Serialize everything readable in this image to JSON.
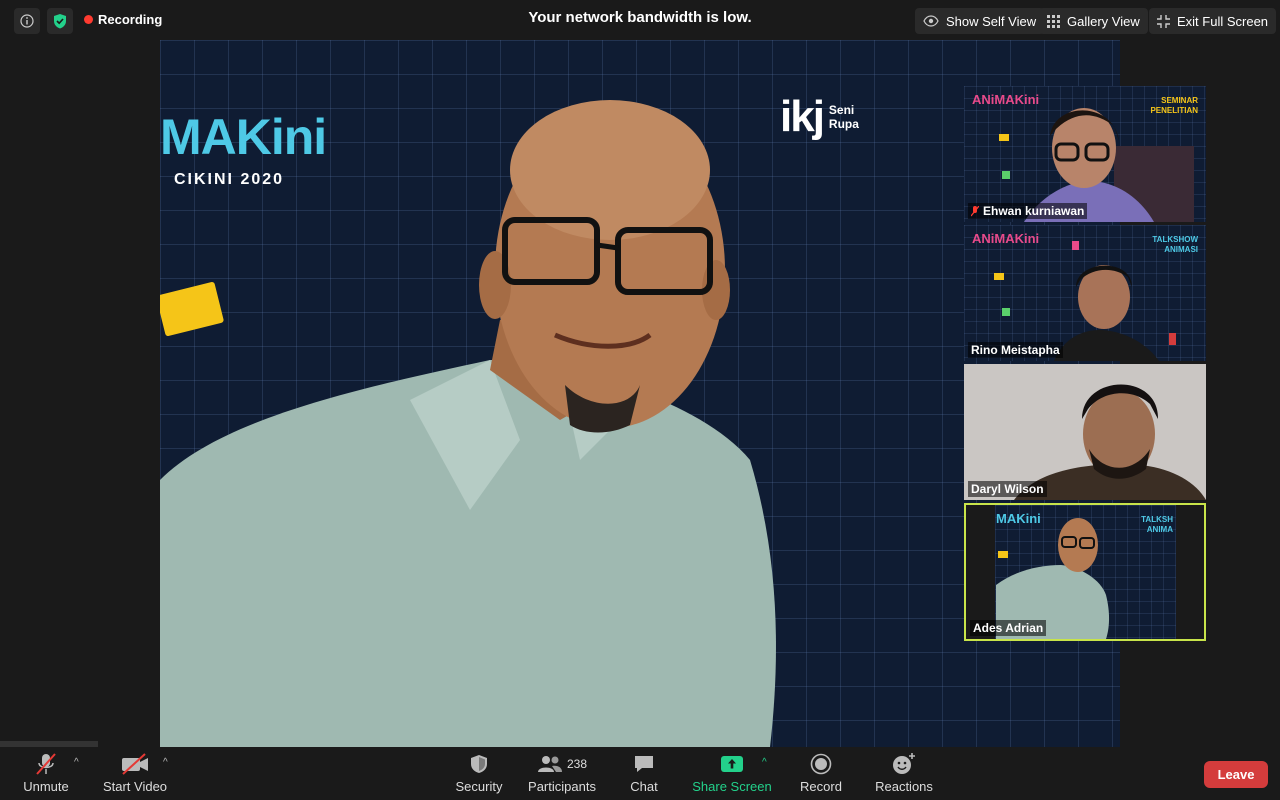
{
  "topbar": {
    "recording_label": "Recording",
    "network_notice": "Your network bandwidth is low.",
    "show_self_view": "Show Self View",
    "gallery_view": "Gallery View",
    "exit_full_screen": "Exit Full Screen"
  },
  "main_video": {
    "logo_text": "MAKini",
    "logo_sub": "CIKINI 2020",
    "ikj_mark": "ikj",
    "ikj_tag_1": "Seni",
    "ikj_tag_2": "Rupa"
  },
  "participants": [
    {
      "name": "Ehwan kurniawan",
      "muted": true,
      "overlay_1": "SEMINAR",
      "overlay_2": "PENELITIAN"
    },
    {
      "name": "Rino Meistapha",
      "muted": false,
      "overlay_1": "TALKSHOW",
      "overlay_2": "ANIMASI"
    },
    {
      "name": "Daryl Wilson",
      "muted": false,
      "overlay_1": "",
      "overlay_2": ""
    },
    {
      "name": "Ades Adrian",
      "muted": false,
      "overlay_1": "TALKSH",
      "overlay_2": "ANIMA",
      "active": true
    }
  ],
  "toolbar": {
    "unmute": "Unmute",
    "start_video": "Start Video",
    "security": "Security",
    "participants": "Participants",
    "participants_count": "238",
    "chat": "Chat",
    "share_screen": "Share Screen",
    "record": "Record",
    "reactions": "Reactions",
    "leave": "Leave"
  },
  "colors": {
    "accent_green": "#23d18b",
    "leave_red": "#d43c3c",
    "active_speaker": "#c8e44a",
    "video_bg": "#0f1c33"
  }
}
